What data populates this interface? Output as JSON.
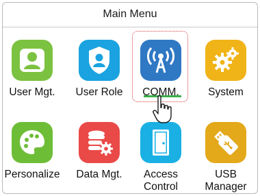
{
  "window": {
    "title": "Main Menu"
  },
  "menu_items": [
    {
      "label": "User Mgt.",
      "icon": "user-icon",
      "color": "#7cc241",
      "selected": false
    },
    {
      "label": "User Role",
      "icon": "user-shield-icon",
      "color": "#1aa3e0",
      "selected": false
    },
    {
      "label": "COMM.",
      "icon": "signal-tower-icon",
      "color": "#2f78c4",
      "selected": true
    },
    {
      "label": "System",
      "icon": "gears-icon",
      "color": "#f0b419",
      "selected": false
    },
    {
      "label": "Personalize",
      "icon": "palette-icon",
      "color": "#6ebd37",
      "selected": false
    },
    {
      "label": "Data Mgt.",
      "icon": "database-gear-icon",
      "color": "#e94a48",
      "selected": false
    },
    {
      "label": "Access\nControl",
      "icon": "door-icon",
      "color": "#1ab0e4",
      "selected": false
    },
    {
      "label": "USB\nManager",
      "icon": "usb-drive-icon",
      "color": "#e3a91b",
      "selected": false
    }
  ],
  "accent_colors": {
    "selection_border": "#d83a3a",
    "selection_underline": "#3cae4a"
  }
}
